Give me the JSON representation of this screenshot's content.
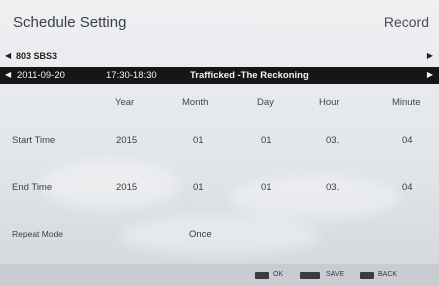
{
  "header": {
    "title": "Schedule Setting",
    "record": "Record"
  },
  "channel": {
    "name": "803 SBS3"
  },
  "program": {
    "date": "2011-09-20",
    "time": "17:30-18:30",
    "title": "Trafficked -The Reckoning"
  },
  "columns": [
    "Year",
    "Month",
    "Day",
    "Hour",
    "Minute"
  ],
  "start": {
    "label": "Start Time",
    "values": [
      "2015",
      "01",
      "01",
      "03.",
      "04"
    ]
  },
  "end": {
    "label": "End Time",
    "values": [
      "2015",
      "01",
      "01",
      "03.",
      "04"
    ]
  },
  "repeat": {
    "label": "Repeat Mode",
    "value": "Once"
  },
  "footer": {
    "ok": "OK",
    "save": "SAVE",
    "back": "BACK"
  },
  "icons": {
    "left": "arrow-left-icon",
    "right": "arrow-right-icon"
  }
}
